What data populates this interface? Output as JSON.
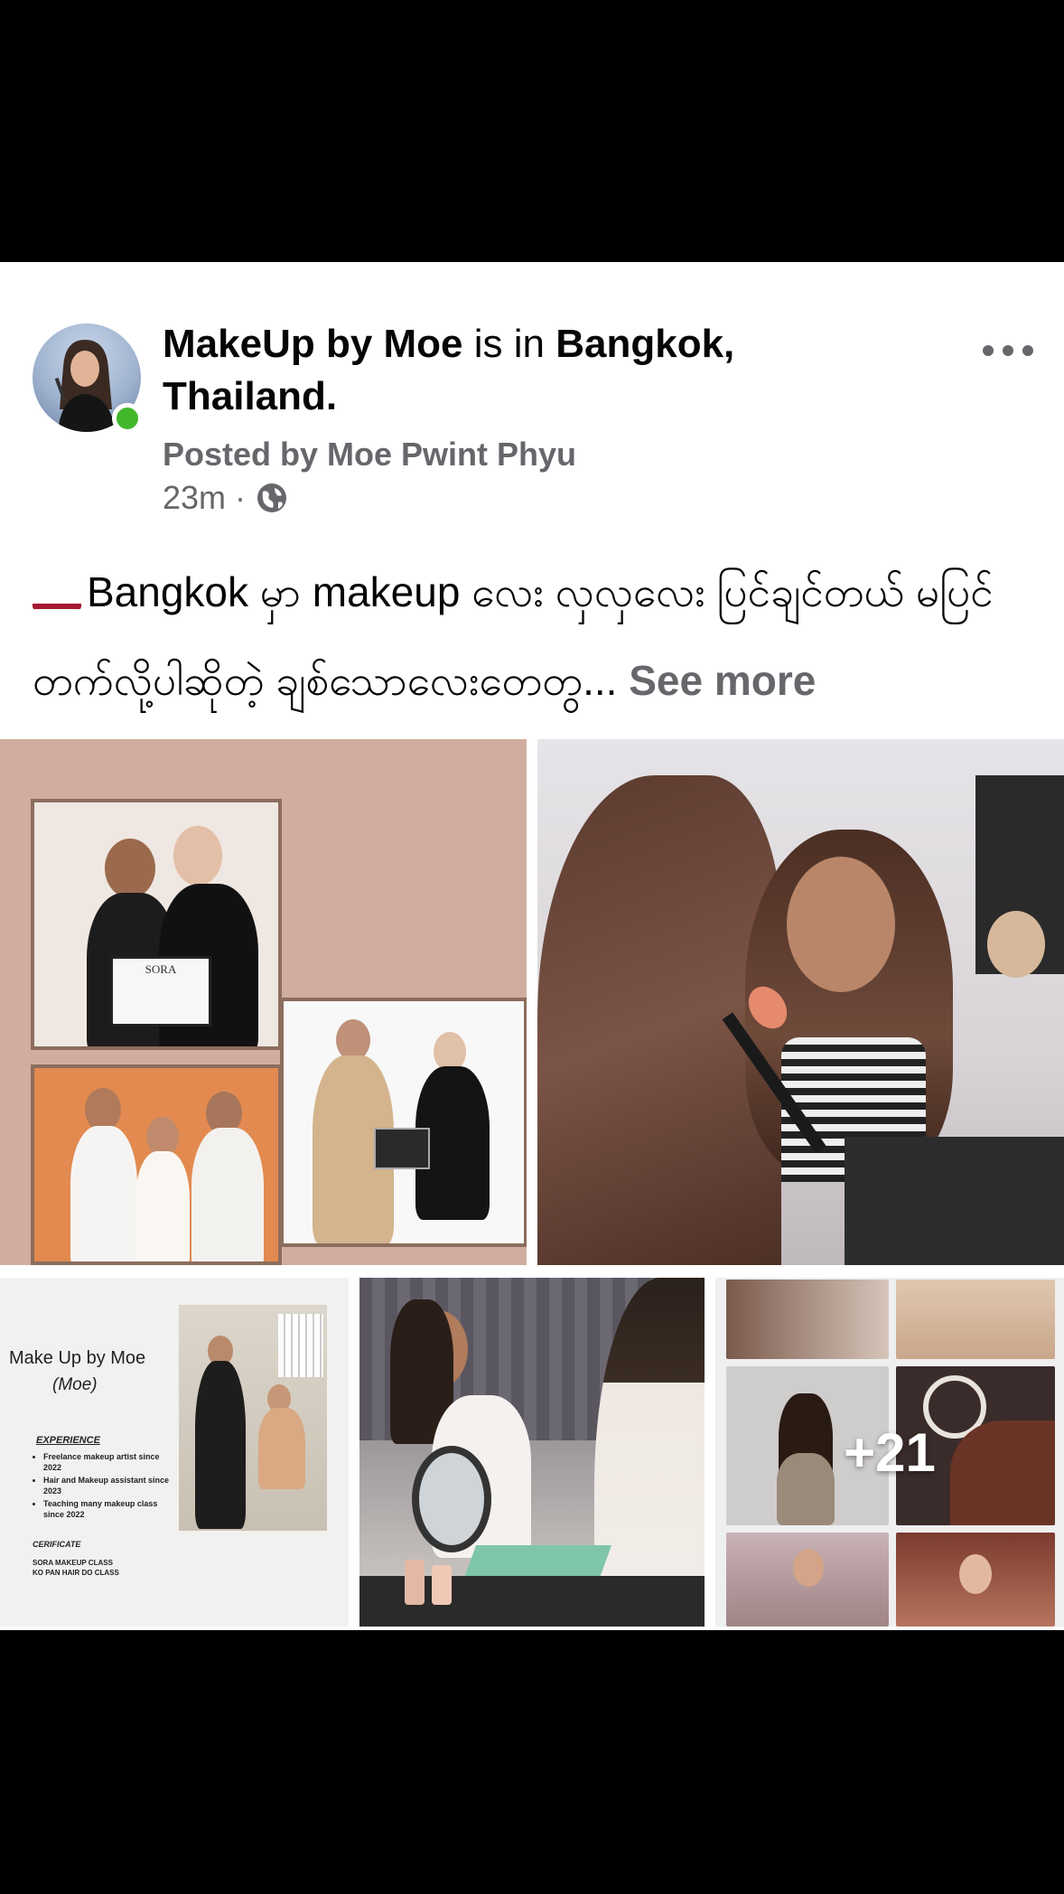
{
  "post": {
    "page_name": "MakeUp by Moe",
    "is_in": "is in",
    "location": "Bangkok, Thailand.",
    "posted_by": "Posted by Moe Pwint Phyu",
    "time": "23m",
    "separator": "·",
    "audience_icon": "globe-icon",
    "online_status_color": "#42b72a",
    "text": "Bangkok မှာ makeup လေး လှလှလေး ပြင်ချင်တယ် မပြင်တက်လို့ပါဆိုတဲ့ ချစ်သောလေးတေတွ...",
    "see_more": "See more",
    "flag_icon": "thailand-flag-icon"
  },
  "photos": {
    "certificate_label": "SORA",
    "resume": {
      "name": "Make Up by Moe",
      "nickname": "(Moe)",
      "experience_heading": "EXPERIENCE",
      "experience": [
        "Freelance makeup artist since 2022",
        "Hair and Makeup assistant since 2023",
        "Teaching many makeup class since 2022"
      ],
      "cert_heading": "CERIFICATE",
      "classes": [
        "SORA MAKEUP CLASS",
        "KO PAN HAIR DO CLASS"
      ]
    },
    "more_count": "+21"
  },
  "colors": {
    "text": "#050505",
    "secondary": "#65676b",
    "card_bg": "#ffffff"
  }
}
